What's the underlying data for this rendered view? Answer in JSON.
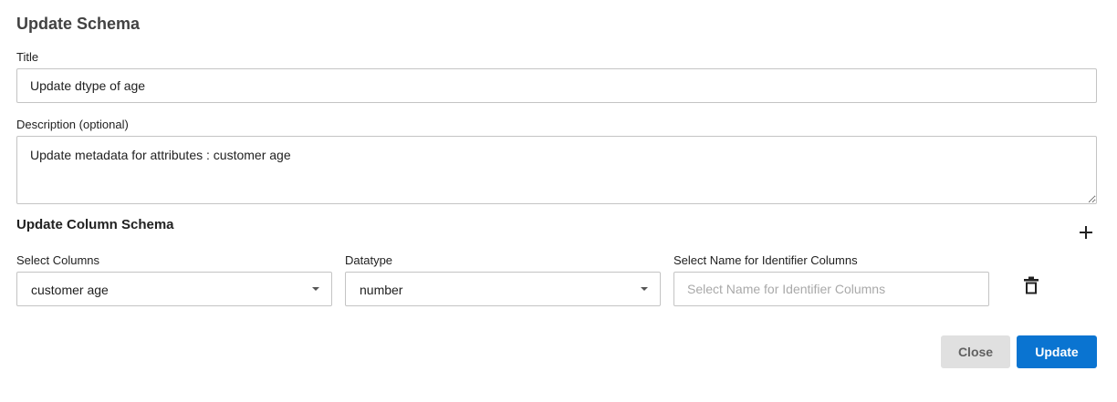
{
  "dialog": {
    "title": "Update Schema"
  },
  "title_field": {
    "label": "Title",
    "value": "Update dtype of age"
  },
  "description_field": {
    "label": "Description (optional)",
    "value": "Update metadata for attributes : customer age"
  },
  "column_schema": {
    "section_title": "Update Column Schema",
    "add_icon": "plus-icon",
    "select_columns": {
      "label": "Select Columns",
      "value": "customer age"
    },
    "datatype": {
      "label": "Datatype",
      "value": "number"
    },
    "identifier": {
      "label": "Select Name for Identifier Columns",
      "value": "",
      "placeholder": "Select Name for Identifier Columns"
    },
    "delete_icon": "trash-icon"
  },
  "actions": {
    "close_label": "Close",
    "update_label": "Update"
  },
  "colors": {
    "primary": "#0a74d1",
    "secondary_button": "#e0e0e0",
    "border": "#c4c4c4"
  }
}
